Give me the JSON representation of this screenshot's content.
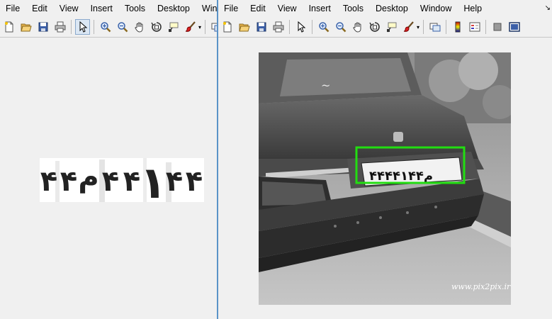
{
  "left_window": {
    "menu": [
      "File",
      "Edit",
      "View",
      "Insert",
      "Tools",
      "Desktop",
      "Windo"
    ]
  },
  "right_window": {
    "menu": [
      "File",
      "Edit",
      "View",
      "Insert",
      "Tools",
      "Desktop",
      "Window",
      "Help"
    ],
    "pin_glyph": "↘"
  },
  "plate": {
    "digits": [
      "۴",
      "۴",
      "م",
      "۴",
      "۴",
      "۱",
      "۴",
      "۴"
    ]
  },
  "photo": {
    "watermark": "www.pix2pix.ir",
    "detection_box_color": "#22dd11"
  },
  "toolbar_icons": {
    "common": [
      "new-figure-icon",
      "open-file-icon",
      "save-icon",
      "print-icon",
      "select-arrow-icon",
      "zoom-in-icon",
      "zoom-out-icon",
      "pan-hand-icon",
      "rotate-3d-icon",
      "data-cursor-icon",
      "brush-icon",
      "link-plot-icon"
    ],
    "right_extra": [
      "colorbar-icon",
      "legend-icon",
      "hide-plot-tools-icon",
      "show-plot-tools-icon"
    ]
  }
}
